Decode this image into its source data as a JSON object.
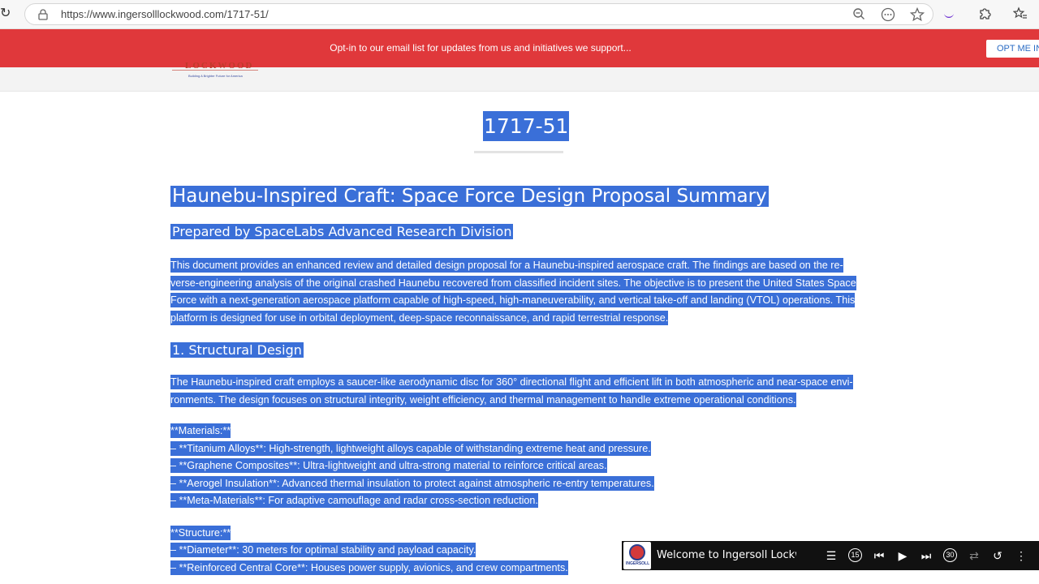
{
  "browser": {
    "url": "https://www.ingersolllockwood.com/1717-51/"
  },
  "banner": {
    "text": "Opt-in to our email list for updates from us and initiatives we support...",
    "button": "OPT ME IN"
  },
  "site": {
    "logo_word": "LOCKWOOD",
    "tagline": "Building A Brighter Future for America"
  },
  "page": {
    "title": "1717-51",
    "heading": "Haunebu-Inspired Craft: Space Force Design Proposal Summary",
    "subheading": "Prepared by SpaceLabs Advanced Research Division",
    "intro_lines": [
      "This document provides an enhanced review and detailed design proposal for a Haunebu-inspired aerospace craft. The findings are based on the re-",
      "verse-engineering analysis of the original crashed Haunebu recovered from classified incident sites. The objective is to present the United States Space",
      "Force with a next-generation aerospace platform capable of high-speed, high-maneuverability, and vertical take-off and landing (VTOL) operations. This",
      "platform is designed for use in orbital deployment, deep-space reconnaissance, and rapid terrestrial response."
    ],
    "section1_title": "1. Structural Design",
    "section1_lines": [
      "The Haunebu-inspired craft employs a saucer-like aerodynamic disc for 360° directional flight and efficient lift in both atmospheric and near-space envi-",
      "ronments. The design focuses on structural integrity, weight efficiency, and thermal management to handle extreme operational conditions."
    ],
    "materials_lines": [
      "**Materials:**",
      "– **Titanium Alloys**: High-strength, lightweight alloys capable of withstanding extreme heat and pressure.",
      "– **Graphene Composites**: Ultra-lightweight and ultra-strong material to reinforce critical areas.",
      "– **Aerogel Insulation**: Advanced thermal insulation to protect against atmospheric re-entry temperatures.",
      "– **Meta-Materials**: For adaptive camouflage and radar cross-section reduction."
    ],
    "structure_lines": [
      "**Structure:**",
      "– **Diameter**: 30 meters for optimal stability and payload capacity.",
      "– **Reinforced Central Core**: Houses power supply, avionics, and crew compartments."
    ]
  },
  "player": {
    "title": "Welcome to Ingersoll Lockwood",
    "logo_caption": "INGERSOLL"
  },
  "colors": {
    "banner_bg": "#e0383b",
    "selection": "#3a6fd8",
    "player_bg": "#111111"
  }
}
